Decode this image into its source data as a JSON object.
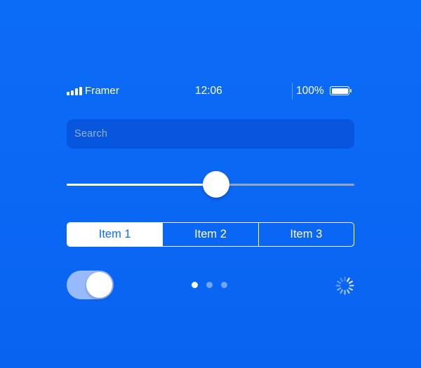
{
  "status_bar": {
    "carrier": "Framer",
    "time": "12:06",
    "battery_percent_text": "100%",
    "signal_icon": "signal-bars-icon",
    "battery_icon": "battery-icon",
    "battery_level": 1.0
  },
  "search": {
    "placeholder": "Search",
    "value": ""
  },
  "slider": {
    "value": 0.5
  },
  "segmented_control": {
    "items": [
      "Item 1",
      "Item 2",
      "Item 3"
    ],
    "selected_index": 0
  },
  "toggle": {
    "on": true
  },
  "page_control": {
    "count": 3,
    "current": 0
  },
  "activity_indicator": {
    "icon": "spinner-icon"
  },
  "colors": {
    "background": "#0b6cf7",
    "search_background": "#0756dd",
    "accent": "#ffffff",
    "track_inactive": "#9aa6b6"
  }
}
